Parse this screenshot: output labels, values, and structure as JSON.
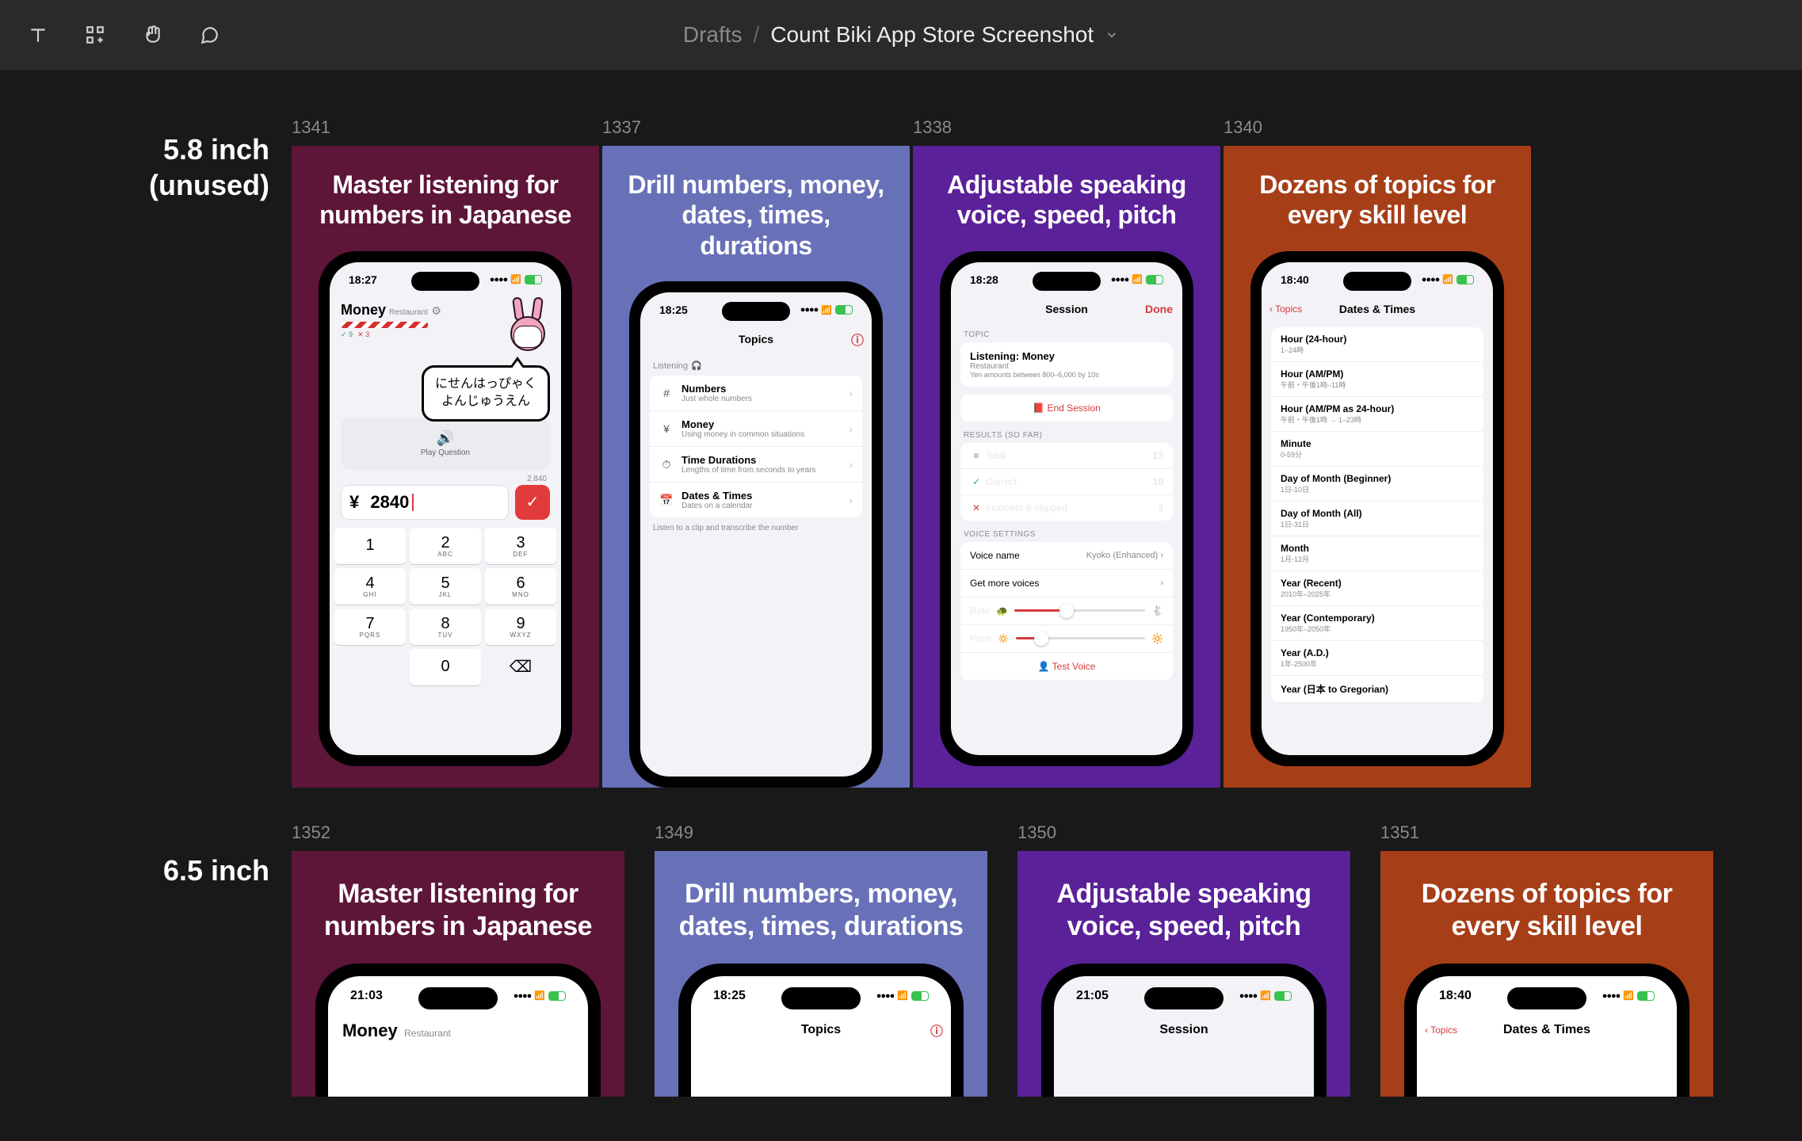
{
  "toolbar": {
    "breadcrumb_parent": "Drafts",
    "breadcrumb_sep": "/",
    "breadcrumb_title": "Count Biki App Store Screenshot"
  },
  "sections": {
    "row1_label_line1": "5.8 inch",
    "row1_label_line2": "(unused)",
    "row2_label": "6.5 inch"
  },
  "frames": {
    "f1": {
      "id": "1341",
      "title": "Master listening for numbers in Japanese"
    },
    "f2": {
      "id": "1337",
      "title": "Drill numbers, money, dates, times, durations"
    },
    "f3": {
      "id": "1338",
      "title": "Adjustable speaking voice, speed, pitch"
    },
    "f4": {
      "id": "1340",
      "title": "Dozens of topics for every skill level"
    },
    "f5": {
      "id": "1352",
      "title": "Master listening for numbers in Japanese"
    },
    "f6": {
      "id": "1349",
      "title": "Drill numbers, money, dates, times, durations"
    },
    "f7": {
      "id": "1350",
      "title": "Adjustable speaking voice, speed, pitch"
    },
    "f8": {
      "id": "1351",
      "title": "Dozens of topics for every skill level"
    }
  },
  "shot1": {
    "time": "18:27",
    "title": "Money",
    "subtitle": "Restaurant",
    "correct": "9",
    "incorrect": "3",
    "speech_l1": "にせんはっぴゃく",
    "speech_l2": "よんじゅうえん",
    "play_label": "Play Question",
    "count": "2,840",
    "value": "2840",
    "currency": "¥",
    "keys": [
      "1",
      "2",
      "3",
      "4",
      "5",
      "6",
      "7",
      "8",
      "9",
      "",
      "0",
      "⌫"
    ],
    "subs": {
      "2": "ABC",
      "3": "DEF",
      "4": "GHI",
      "5": "JKL",
      "6": "MNO",
      "7": "PQRS",
      "8": "TUV",
      "9": "WXYZ"
    }
  },
  "shot2": {
    "time": "18:25",
    "nav_title": "Topics",
    "section": "Listening",
    "footer": "Listen to a clip and transcribe the number",
    "items": [
      {
        "icon": "#",
        "title": "Numbers",
        "sub": "Just whole numbers"
      },
      {
        "icon": "¥",
        "title": "Money",
        "sub": "Using money in common situations"
      },
      {
        "icon": "⏱",
        "title": "Time Durations",
        "sub": "Lengths of time from seconds to years"
      },
      {
        "icon": "📅",
        "title": "Dates & Times",
        "sub": "Dates on a calendar"
      }
    ]
  },
  "shot3": {
    "time": "18:28",
    "nav_title": "Session",
    "done": "Done",
    "topic_section": "TOPIC",
    "topic_title": "Listening: Money",
    "topic_sub": "Restaurant",
    "topic_sub2": "Yen amounts between 800–6,000 by 10s",
    "end_session": "End Session",
    "results_section": "RESULTS (SO FAR)",
    "results": [
      {
        "icon": "≡",
        "cls": "n",
        "label": "Total",
        "value": "13"
      },
      {
        "icon": "✓",
        "cls": "g",
        "label": "Correct",
        "value": "10"
      },
      {
        "icon": "✕",
        "cls": "r",
        "label": "Incorrect & skipped",
        "value": "3"
      }
    ],
    "voice_section": "VOICE SETTINGS",
    "voice_name_label": "Voice name",
    "voice_name_value": "Kyoko (Enhanced)",
    "get_more": "Get more voices",
    "rate_label": "Rate",
    "pitch_label": "Pitch",
    "test_voice": "Test Voice"
  },
  "shot4": {
    "time": "18:40",
    "back": "Topics",
    "nav_title": "Dates & Times",
    "items": [
      {
        "t": "Hour (24-hour)",
        "s": "1–24時"
      },
      {
        "t": "Hour (AM/PM)",
        "s": "午前・午後1時–11時"
      },
      {
        "t": "Hour (AM/PM as 24-hour)",
        "s": "午前・午後1時 → 1–23時"
      },
      {
        "t": "Minute",
        "s": "0-59分"
      },
      {
        "t": "Day of Month (Beginner)",
        "s": "1日-10日"
      },
      {
        "t": "Day of Month (All)",
        "s": "1日-31日"
      },
      {
        "t": "Month",
        "s": "1月-12月"
      },
      {
        "t": "Year (Recent)",
        "s": "2010年–2025年"
      },
      {
        "t": "Year (Contemporary)",
        "s": "1950年–2050年"
      },
      {
        "t": "Year (A.D.)",
        "s": "1年-2500年"
      },
      {
        "t": "Year (日本 to Gregorian)",
        "s": ""
      }
    ]
  },
  "row2_times": {
    "f5": "21:03",
    "f6": "18:25",
    "f7": "21:05",
    "f8": "18:40"
  },
  "row2_nav": {
    "f5_title": "Money",
    "f5_sub": "Restaurant",
    "f6_title": "Topics",
    "f7_title": "Session",
    "f8_back": "Topics",
    "f8_title": "Dates & Times"
  }
}
